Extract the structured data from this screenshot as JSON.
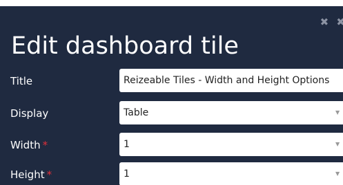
{
  "dialog": {
    "title": "Edit dashboard tile",
    "close_icons": "✖ ✖"
  },
  "form": {
    "title": {
      "label": "Title",
      "value": "Reizeable Tiles - Width and Height Options"
    },
    "display": {
      "label": "Display",
      "value": "Table",
      "caret": "▼"
    },
    "width": {
      "label": "Width",
      "required_mark": "*",
      "value": "1",
      "caret": "▼"
    },
    "height": {
      "label": "Height",
      "required_mark": "*",
      "value": "1",
      "caret": "▼"
    }
  },
  "colors": {
    "dialog_background": "#1f2a40",
    "required_mark": "#e0303a",
    "field_background": "#ffffff"
  }
}
